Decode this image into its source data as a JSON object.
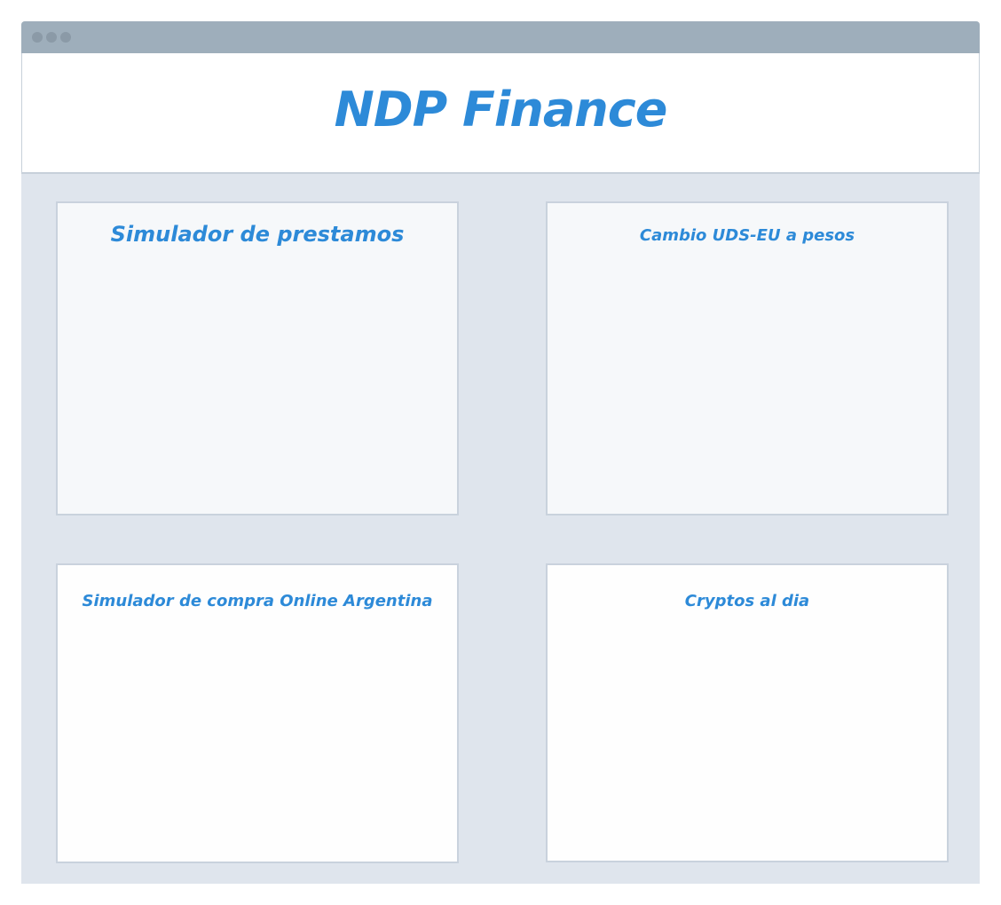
{
  "app": {
    "title": "NDP Finance"
  },
  "cards": [
    {
      "title": "Simulador de prestamos"
    },
    {
      "title": "Cambio UDS-EU a pesos"
    },
    {
      "title": "Simulador de compra Online Argentina"
    },
    {
      "title": "Cryptos al dia"
    }
  ],
  "colors": {
    "accent": "#2d8ad8",
    "titlebar": "#9eaebb",
    "page_background": "#dfe5ed",
    "card_border": "#c9d2dd"
  }
}
